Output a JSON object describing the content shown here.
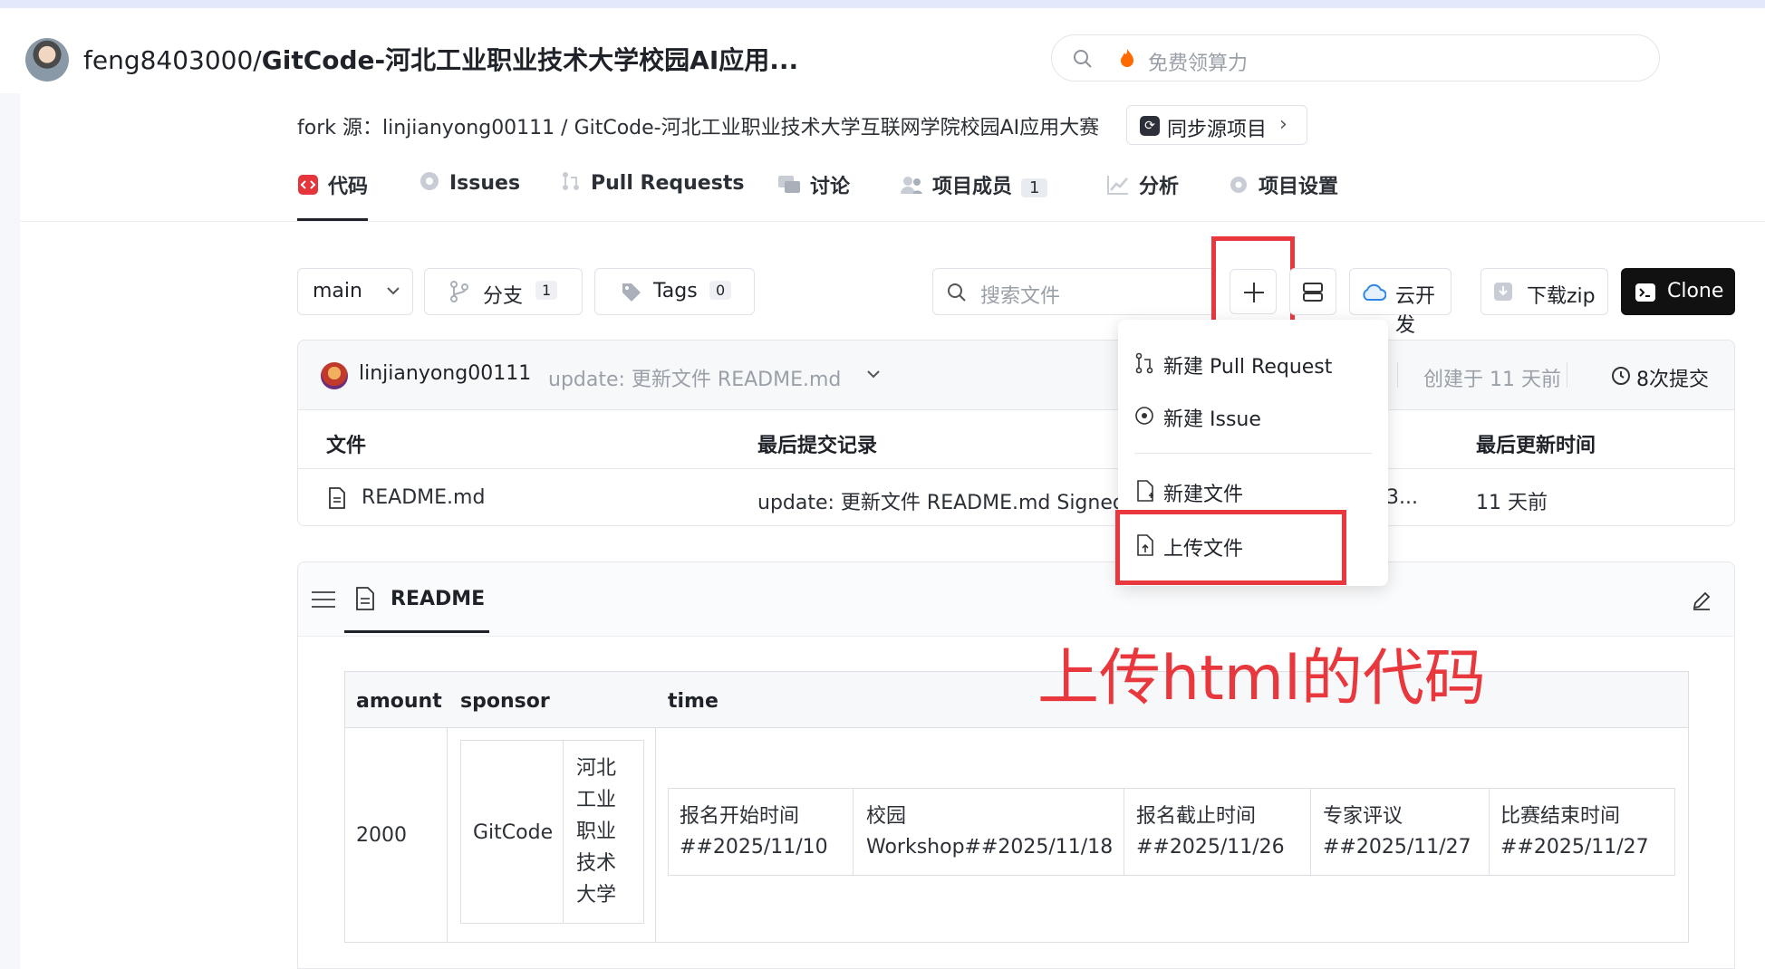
{
  "header": {
    "owner": "feng8403000/",
    "repo": "GitCode-河北工业职业技术大学校园AI应用...",
    "search_placeholder": "免费领算力"
  },
  "fork": {
    "text": "fork 源：linjianyong00111 / GitCode-河北工业职业技术大学互联网学院校园AI应用大赛",
    "sync_label": "同步源项目"
  },
  "tabs": [
    {
      "label": "代码",
      "icon": "code-icon"
    },
    {
      "label": "Issues",
      "icon": "issue-icon"
    },
    {
      "label": "Pull Requests",
      "icon": "pull-request-icon"
    },
    {
      "label": "讨论",
      "icon": "discussion-icon"
    },
    {
      "label": "项目成员",
      "count": "1",
      "icon": "members-icon"
    },
    {
      "label": "分析",
      "icon": "chart-icon"
    },
    {
      "label": "项目设置",
      "icon": "settings-icon"
    }
  ],
  "toolbar": {
    "branch": "main",
    "branches_label": "分支",
    "branches_count": "1",
    "tags_label": "Tags",
    "tags_count": "0",
    "search_placeholder": "搜索文件",
    "cloud_label": "云开发",
    "download_label": "下载zip",
    "clone_label": "Clone"
  },
  "commit": {
    "author": "linjianyong00111",
    "message": "update: 更新文件 README.md",
    "created": "创建于 11 天前",
    "commits": "8次提交"
  },
  "file_table": {
    "headers": [
      "文件",
      "最后提交记录",
      "最后更新时间"
    ],
    "rows": [
      {
        "name": "README.md",
        "commit": "update: 更新文件 README.md Signed",
        "hash_tail": "3...",
        "time": "11 天前"
      }
    ]
  },
  "dropdown": {
    "items": [
      "新建 Pull Request",
      "新建 Issue",
      "新建文件",
      "上传文件"
    ]
  },
  "readme": {
    "title": "README",
    "annotation": "上传html的代码",
    "table": {
      "headers": [
        "amount",
        "sponsor",
        "time"
      ],
      "amount": "2000",
      "sponsor_name": "GitCode",
      "sponsor_org_lines": [
        "河北",
        "工业",
        "职业",
        "技术",
        "大学"
      ],
      "schedule": [
        [
          "报名开始时间",
          "##2025/11/10"
        ],
        [
          "校园",
          "Workshop##2025/11/18"
        ],
        [
          "报名截止时间",
          "##2025/11/26"
        ],
        [
          "专家评议",
          "##2025/11/27"
        ],
        [
          "比赛结束时间",
          "##2025/11/27"
        ]
      ]
    }
  },
  "colors": {
    "accent_red": "#e8383d",
    "clone_bg": "#111111",
    "code_icon": "#e5343a"
  }
}
